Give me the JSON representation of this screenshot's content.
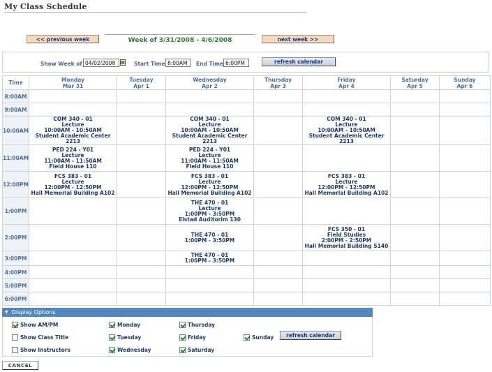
{
  "page": {
    "title": "My Class Schedule"
  },
  "nav": {
    "previous_week": "<< previous week",
    "week_label": "Week of 3/31/2008 - 4/6/2008",
    "next_week": "next week >>"
  },
  "filters": {
    "show_week_label": "Show Week of",
    "show_week_value": "04/02/2008",
    "start_time_label": "Start Time",
    "start_time_value": "8:00AM",
    "end_time_label": "End Time",
    "end_time_value": "6:00PM",
    "refresh_label": "refresh calendar"
  },
  "schedule": {
    "time_header": "Time",
    "days": [
      {
        "name": "Monday",
        "date": "Mar 31"
      },
      {
        "name": "Tuesday",
        "date": "Apr 1"
      },
      {
        "name": "Wednesday",
        "date": "Apr 2"
      },
      {
        "name": "Thursday",
        "date": "Apr 3"
      },
      {
        "name": "Friday",
        "date": "Apr 4"
      },
      {
        "name": "Saturday",
        "date": "Apr 5"
      },
      {
        "name": "Sunday",
        "date": "Apr 6"
      }
    ],
    "rows": [
      {
        "time": "8:00AM",
        "cells": [
          [],
          [],
          [],
          [],
          [],
          [],
          []
        ]
      },
      {
        "time": "9:00AM",
        "cells": [
          [],
          [],
          [],
          [],
          [],
          [],
          []
        ]
      },
      {
        "time": "10:00AM",
        "cells": [
          [
            "COM 340 - 01",
            "Lecture",
            "10:00AM - 10:50AM",
            "Student Academic Center 2213"
          ],
          [],
          [
            "COM 340 - 01",
            "Lecture",
            "10:00AM - 10:50AM",
            "Student Academic Center 2213"
          ],
          [],
          [
            "COM 340 - 01",
            "Lecture",
            "10:00AM - 10:50AM",
            "Student Academic Center 2213"
          ],
          [],
          []
        ]
      },
      {
        "time": "11:00AM",
        "cells": [
          [
            "PED 224 - Y01",
            "Lecture",
            "11:00AM - 11:50AM",
            "Field House 110"
          ],
          [],
          [
            "PED 224 - Y01",
            "Lecture",
            "11:00AM - 11:50AM",
            "Field House 110"
          ],
          [],
          [],
          [],
          []
        ]
      },
      {
        "time": "12:00PM",
        "cells": [
          [
            "FCS 383 - 01",
            "Lecture",
            "12:00PM - 12:50PM",
            "Hall Memorial Building A102"
          ],
          [],
          [
            "FCS 383 - 01",
            "Lecture",
            "12:00PM - 12:50PM",
            "Hall Memorial Building A102"
          ],
          [],
          [
            "FCS 383 - 01",
            "Lecture",
            "12:00PM - 12:50PM",
            "Hall Memorial Building A102"
          ],
          [],
          []
        ]
      },
      {
        "time": "1:00PM",
        "cells": [
          [],
          [],
          [
            "THE 470 - 01",
            "Lecture",
            "1:00PM - 3:50PM",
            "Elstad Auditorim 130"
          ],
          [],
          [],
          [],
          []
        ]
      },
      {
        "time": "2:00PM",
        "cells": [
          [],
          [],
          [
            "THE 470 - 01",
            "1:00PM - 3:50PM"
          ],
          [],
          [
            "FCS 350 - 01",
            "Field Studies",
            "2:00PM - 2:50PM",
            "Hall Memorial Building S140"
          ],
          [],
          []
        ]
      },
      {
        "time": "3:00PM",
        "cells": [
          [],
          [],
          [
            "THE 470 - 01",
            "1:00PM - 3:50PM"
          ],
          [],
          [],
          [],
          []
        ]
      },
      {
        "time": "4:00PM",
        "cells": [
          [],
          [],
          [],
          [],
          [],
          [],
          []
        ]
      },
      {
        "time": "5:00PM",
        "cells": [
          [],
          [],
          [],
          [],
          [],
          [],
          []
        ]
      },
      {
        "time": "6:00PM",
        "cells": [
          [],
          [],
          [],
          [],
          [],
          [],
          []
        ]
      }
    ]
  },
  "display_options": {
    "title": "Display Options",
    "show_ampm": {
      "label": "Show AM/PM",
      "checked": true
    },
    "show_class_title": {
      "label": "Show Class Title",
      "checked": false
    },
    "show_instructors": {
      "label": "Show Instructors",
      "checked": false
    },
    "monday": {
      "label": "Monday",
      "checked": true
    },
    "tuesday": {
      "label": "Tuesday",
      "checked": true
    },
    "wednesday": {
      "label": "Wednesday",
      "checked": true
    },
    "thursday": {
      "label": "Thursday",
      "checked": true
    },
    "friday": {
      "label": "Friday",
      "checked": true
    },
    "saturday": {
      "label": "Saturday",
      "checked": true
    },
    "sunday": {
      "label": "Sunday",
      "checked": true
    },
    "refresh_label": "refresh calendar"
  },
  "footer": {
    "cancel_label": "CANCEL"
  }
}
